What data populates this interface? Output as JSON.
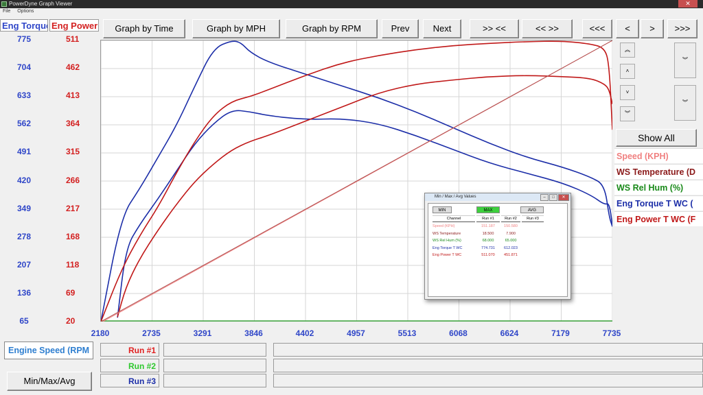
{
  "window": {
    "title": "PowerDyne Graph Viewer",
    "menu": [
      "File",
      "Options"
    ],
    "close": "✕"
  },
  "toolbar": {
    "graph_time": "Graph by Time",
    "graph_mph": "Graph by MPH",
    "graph_rpm": "Graph by RPM",
    "prev": "Prev",
    "next": "Next",
    "zoom_in": ">> <<",
    "zoom_out": "<< >>",
    "first": "<<<",
    "back": "<",
    "fwd": ">",
    "last": ">>>"
  },
  "left_axis": {
    "label": "Eng Torque",
    "color": "#2f46c8",
    "ticks": [
      "775",
      "704",
      "633",
      "562",
      "491",
      "420",
      "349",
      "278",
      "207",
      "136",
      "65"
    ]
  },
  "right_axis": {
    "label": "Eng Power",
    "color": "#d32020",
    "ticks": [
      "511",
      "462",
      "413",
      "364",
      "315",
      "266",
      "217",
      "168",
      "118",
      "69",
      "20"
    ]
  },
  "x_axis": {
    "label": "Engine Speed (RPM",
    "ticks": [
      "2180",
      "2735",
      "3291",
      "3846",
      "4402",
      "4957",
      "5513",
      "6068",
      "6624",
      "7179",
      "7735"
    ]
  },
  "side_controls": {
    "show_all": "Show All",
    "scroll_up_fast": "︽",
    "scroll_up": "˄",
    "scroll_down": "˅",
    "scroll_down_fast": "︾"
  },
  "channels": [
    {
      "label": "Speed (KPH)",
      "color": "#f08080"
    },
    {
      "label": "WS Temperature (D",
      "color": "#8b1a1a"
    },
    {
      "label": "WS Rel Hum (%)",
      "color": "#1a8a1a"
    },
    {
      "label": "Eng Torque T WC (",
      "color": "#1c2ea8"
    },
    {
      "label": "Eng Power T WC (F",
      "color": "#c01818"
    }
  ],
  "runs": [
    {
      "label": "Run #1",
      "color": "#e02020"
    },
    {
      "label": "Run #2",
      "color": "#2ec82e"
    },
    {
      "label": "Run #3",
      "color": "#1c2ea8"
    }
  ],
  "bottom": {
    "minmax_button": "Min/Max/Avg"
  },
  "popup": {
    "title": "Min / Max / Avg Values",
    "min": "MIN",
    "max": "MAX",
    "avg": "AVG",
    "headers": [
      "Channel",
      "Run #1",
      "Run #2",
      "Run #3"
    ],
    "rows": [
      {
        "channel": "Speed (KPH)",
        "run1": "151.187",
        "run2": "150.580",
        "run3": "",
        "color": "#f08080"
      },
      {
        "channel": "WS Temperature",
        "run1": "18.500",
        "run2": "7.900",
        "run3": "",
        "color": "#8b1a1a"
      },
      {
        "channel": "WS Rel Hum (%)",
        "run1": "68.000",
        "run2": "65.000",
        "run3": "",
        "color": "#1a8a1a"
      },
      {
        "channel": "Eng Torque T WC",
        "run1": "774.731",
        "run2": "612.023",
        "run3": "",
        "color": "#1c2ea8"
      },
      {
        "channel": "Eng Power T WC",
        "run1": "511.070",
        "run2": "451.871",
        "run3": "",
        "color": "#c01818"
      }
    ]
  },
  "chart_data": {
    "type": "line",
    "xlabel": "Engine Speed (RPM",
    "ylabel_left": "Eng Torque",
    "ylabel_right": "Eng Power",
    "xlim": [
      2180,
      7735
    ],
    "ylim_left": [
      65,
      775
    ],
    "ylim_right": [
      20,
      511
    ],
    "grid": true,
    "series": [
      {
        "name": "Eng Torque T WC Run #1",
        "axis": "left",
        "color": "#1c2ea8",
        "x": [
          2180,
          2400,
          2600,
          2800,
          3000,
          3200,
          3400,
          3600,
          3700,
          3800,
          4000,
          4400,
          4800,
          5200,
          5600,
          6000,
          6400,
          6800,
          7200,
          7500,
          7650,
          7700,
          7735
        ],
        "y": [
          65,
          330,
          400,
          480,
          560,
          660,
          755,
          775,
          770,
          745,
          720,
          690,
          660,
          630,
          595,
          555,
          515,
          480,
          455,
          430,
          410,
          330,
          305
        ]
      },
      {
        "name": "Eng Torque T WC Run #2",
        "axis": "left",
        "color": "#1c2ea8",
        "x": [
          2360,
          2450,
          2600,
          2800,
          3000,
          3200,
          3400,
          3600,
          3800,
          4000,
          4400,
          4800,
          5200,
          5600,
          6000,
          6400,
          6800,
          7200,
          7500,
          7650,
          7700,
          7735
        ],
        "y": [
          75,
          250,
          310,
          375,
          445,
          515,
          565,
          600,
          595,
          585,
          575,
          578,
          565,
          535,
          500,
          465,
          440,
          415,
          385,
          360,
          365,
          310
        ]
      },
      {
        "name": "Eng Power T WC Run #1",
        "axis": "right",
        "color": "#c01818",
        "x": [
          2180,
          2400,
          2600,
          2800,
          3000,
          3200,
          3400,
          3600,
          3800,
          4000,
          4400,
          4800,
          5200,
          5600,
          6000,
          6400,
          6800,
          7200,
          7500,
          7650,
          7700,
          7735
        ],
        "y": [
          20,
          110,
          170,
          220,
          280,
          335,
          380,
          405,
          413,
          425,
          450,
          472,
          485,
          495,
          502,
          506,
          509,
          510,
          505,
          498,
          470,
          355
        ]
      },
      {
        "name": "Eng Power T WC Run #2",
        "axis": "right",
        "color": "#c01818",
        "x": [
          2360,
          2450,
          2600,
          2800,
          3000,
          3200,
          3400,
          3600,
          3800,
          4000,
          4400,
          4800,
          5200,
          5600,
          6000,
          6400,
          6800,
          7200,
          7500,
          7650,
          7700,
          7735
        ],
        "y": [
          28,
          80,
          130,
          180,
          225,
          265,
          295,
          320,
          335,
          345,
          370,
          395,
          420,
          435,
          442,
          448,
          450,
          448,
          445,
          435,
          425,
          400
        ]
      },
      {
        "name": "Speed (KPH) Run #1",
        "axis": "left",
        "color": "#f08080",
        "x": [
          2200,
          7735
        ],
        "y": [
          65,
          775
        ]
      },
      {
        "name": "Speed (KPH) Run #2",
        "axis": "left",
        "color": "#b05050",
        "x": [
          2180,
          7735
        ],
        "y": [
          65,
          800
        ]
      }
    ]
  }
}
